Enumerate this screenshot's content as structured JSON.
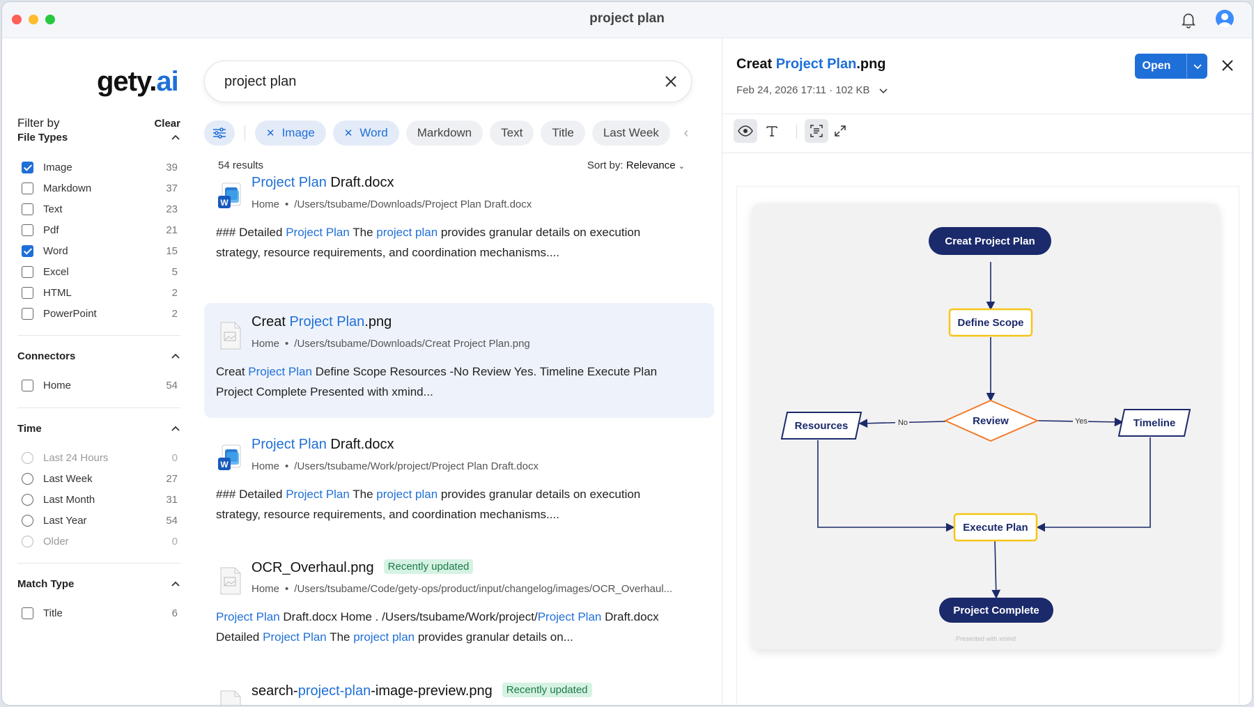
{
  "window": {
    "title": "project plan"
  },
  "sidebar": {
    "logo_main": "gety.",
    "logo_accent": "ai",
    "filter_by": "Filter by",
    "clear": "Clear",
    "file_types": {
      "title": "File Types",
      "items": [
        {
          "label": "Image",
          "count": "39",
          "checked": true
        },
        {
          "label": "Markdown",
          "count": "37",
          "checked": false
        },
        {
          "label": "Text",
          "count": "23",
          "checked": false
        },
        {
          "label": "Pdf",
          "count": "21",
          "checked": false
        },
        {
          "label": "Word",
          "count": "15",
          "checked": true
        },
        {
          "label": "Excel",
          "count": "5",
          "checked": false
        },
        {
          "label": "HTML",
          "count": "2",
          "checked": false
        },
        {
          "label": "PowerPoint",
          "count": "2",
          "checked": false
        }
      ]
    },
    "connectors": {
      "title": "Connectors",
      "items": [
        {
          "label": "Home",
          "count": "54"
        }
      ]
    },
    "time": {
      "title": "Time",
      "items": [
        {
          "label": "Last 24 Hours",
          "count": "0",
          "disabled": true
        },
        {
          "label": "Last Week",
          "count": "27",
          "disabled": false
        },
        {
          "label": "Last Month",
          "count": "31",
          "disabled": false
        },
        {
          "label": "Last Year",
          "count": "54",
          "disabled": false
        },
        {
          "label": "Older",
          "count": "0",
          "disabled": true
        }
      ]
    },
    "match_type": {
      "title": "Match Type",
      "items": [
        {
          "label": "Title",
          "count": "6"
        }
      ]
    }
  },
  "search": {
    "value": "project plan"
  },
  "chips": [
    {
      "label": "Image",
      "active": true
    },
    {
      "label": "Word",
      "active": true
    },
    {
      "label": "Markdown",
      "active": false
    },
    {
      "label": "Text",
      "active": false
    },
    {
      "label": "Title",
      "active": false
    },
    {
      "label": "Last Week",
      "active": false
    }
  ],
  "results_meta": {
    "count": "54 results",
    "sort_label": "Sort by:",
    "sort_value": "Relevance"
  },
  "results": [
    {
      "file_type": "word",
      "title_hl": "Project Plan",
      "title_rest": " Draft.docx",
      "location": "Home",
      "path": "/Users/tsubame/Downloads/Project Plan Draft.docx",
      "snippet_1": "### Detailed ",
      "snippet_hl1": "Project Plan",
      "snippet_2": " The ",
      "snippet_hl2": "project plan",
      "snippet_3": " provides granular details on execution strategy, resource requirements, and coordination mechanisms...."
    },
    {
      "file_type": "png",
      "title_pre": "Creat ",
      "title_hl": "Project Plan",
      "title_rest": ".png",
      "location": "Home",
      "path": "/Users/tsubame/Downloads/Creat Project Plan.png",
      "snippet_1": "Creat ",
      "snippet_hl1": "Project Plan",
      "snippet_2": " Define Scope Resources -No Review Yes. Timeline Execute Plan Project Complete Presented with xmind..."
    },
    {
      "file_type": "word",
      "title_hl": "Project Plan",
      "title_rest": " Draft.docx",
      "location": "Home",
      "path": "/Users/tsubame/Work/project/Project Plan Draft.docx",
      "snippet_1": "### Detailed ",
      "snippet_hl1": "Project Plan",
      "snippet_2": " The ",
      "snippet_hl2": "project plan",
      "snippet_3": " provides granular details on execution strategy, resource requirements, and coordination mechanisms...."
    },
    {
      "file_type": "png",
      "title": "OCR_Overhaul.png",
      "badge": "Recently updated",
      "location": "Home",
      "path": "/Users/tsubame/Code/gety-ops/product/input/changelog/images/OCR_Overhaul...",
      "snippet_hl1": "Project Plan",
      "snippet_1": " Draft.docx Home . /Users/tsubame/Work/project/",
      "snippet_hl2": "Project Plan",
      "snippet_2": " Draft.docx Detailed ",
      "snippet_hl3": "Project Plan",
      "snippet_3": " The ",
      "snippet_hl4": "project plan",
      "snippet_4": " provides granular details on..."
    },
    {
      "file_type": "png",
      "title_pre": "search-",
      "title_hl": "project-plan",
      "title_rest": "-image-preview.png",
      "badge": "Recently updated"
    }
  ],
  "preview": {
    "title_pre": "Creat ",
    "title_hl": "Project Plan",
    "title_rest": ".png",
    "meta": "Feb 24, 2026 17:11 · 102 KB",
    "open_label": "Open",
    "flowchart": {
      "start": "Creat Project Plan",
      "scope": "Define Scope",
      "review": "Review",
      "resources": "Resources",
      "timeline": "Timeline",
      "execute": "Execute Plan",
      "complete": "Project Complete",
      "no_label": "No",
      "yes_label": "Yes",
      "watermark": "Presented with xmind"
    }
  },
  "colors": {
    "accent": "#1f6fd8",
    "badge_bg": "#d6f2e3",
    "flow_navy": "#1b2a6b",
    "flow_yellow": "#f5c518",
    "flow_orange": "#f07b2a"
  }
}
